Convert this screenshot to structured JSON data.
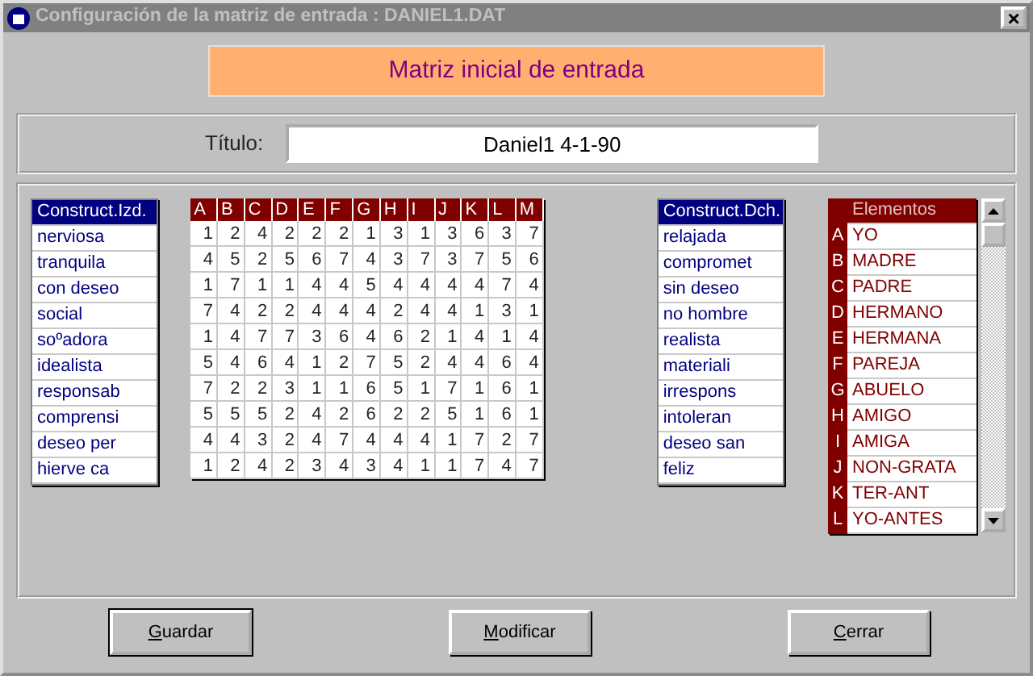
{
  "window": {
    "title": "Configuración de la matriz de entrada : DANIEL1.DAT",
    "close": "×"
  },
  "banner": "Matriz inicial de entrada",
  "title_field": {
    "label": "Título:",
    "value": "Daniel1 4-1-90"
  },
  "left_constructs": {
    "header": "Construct.Izd.",
    "header_selected": true,
    "items": [
      "nerviosa",
      "tranquila",
      "con deseo",
      "social",
      "soºadora",
      "idealista",
      "responsab",
      "comprensi",
      "deseo per",
      "hierve ca"
    ]
  },
  "matrix": {
    "columns": [
      "A",
      "B",
      "C",
      "D",
      "E",
      "F",
      "G",
      "H",
      "I",
      "J",
      "K",
      "L",
      "M"
    ],
    "rows": [
      [
        "1",
        "2",
        "4",
        "2",
        "2",
        "2",
        "1",
        "3",
        "1",
        "3",
        "6",
        "3",
        "7"
      ],
      [
        "4",
        "5",
        "2",
        "5",
        "6",
        "7",
        "4",
        "3",
        "7",
        "3",
        "7",
        "5",
        "6"
      ],
      [
        "1",
        "7",
        "1",
        "1",
        "4",
        "4",
        "5",
        "4",
        "4",
        "4",
        "4",
        "7",
        "4"
      ],
      [
        "7",
        "4",
        "2",
        "2",
        "4",
        "4",
        "4",
        "2",
        "4",
        "4",
        "1",
        "3",
        "1"
      ],
      [
        "1",
        "4",
        "7",
        "7",
        "3",
        "6",
        "4",
        "6",
        "2",
        "1",
        "4",
        "1",
        "4"
      ],
      [
        "5",
        "4",
        "6",
        "4",
        "1",
        "2",
        "7",
        "5",
        "2",
        "4",
        "4",
        "6",
        "4"
      ],
      [
        "7",
        "2",
        "2",
        "3",
        "1",
        "1",
        "6",
        "5",
        "1",
        "7",
        "1",
        "6",
        "1"
      ],
      [
        "5",
        "5",
        "5",
        "2",
        "4",
        "2",
        "6",
        "2",
        "2",
        "5",
        "1",
        "6",
        "1"
      ],
      [
        "4",
        "4",
        "3",
        "2",
        "4",
        "7",
        "4",
        "4",
        "4",
        "1",
        "7",
        "2",
        "7"
      ],
      [
        "1",
        "2",
        "4",
        "2",
        "3",
        "4",
        "3",
        "4",
        "1",
        "1",
        "7",
        "4",
        "7"
      ]
    ]
  },
  "right_constructs": {
    "header": "Construct.Dch.",
    "header_selected": true,
    "items": [
      "relajada",
      "compromet",
      "sin deseo",
      "no hombre",
      "realista",
      "materiali",
      "irrespons",
      "intoleran",
      "deseo san",
      "feliz"
    ]
  },
  "elements": {
    "header": "Elementos",
    "items": [
      {
        "letter": "A",
        "name": "YO"
      },
      {
        "letter": "B",
        "name": "MADRE"
      },
      {
        "letter": "C",
        "name": "PADRE"
      },
      {
        "letter": "D",
        "name": "HERMANO"
      },
      {
        "letter": "E",
        "name": "HERMANA"
      },
      {
        "letter": "F",
        "name": "PAREJA"
      },
      {
        "letter": "G",
        "name": "ABUELO"
      },
      {
        "letter": "H",
        "name": "AMIGO"
      },
      {
        "letter": "I",
        "name": "AMIGA"
      },
      {
        "letter": "J",
        "name": "NON-GRATA"
      },
      {
        "letter": "K",
        "name": "TER-ANT"
      },
      {
        "letter": "L",
        "name": "YO-ANTES"
      }
    ]
  },
  "buttons": [
    {
      "label": "Guardar",
      "default": true
    },
    {
      "label": "Modificar",
      "default": false
    },
    {
      "label": "Cerrar",
      "default": false
    }
  ]
}
